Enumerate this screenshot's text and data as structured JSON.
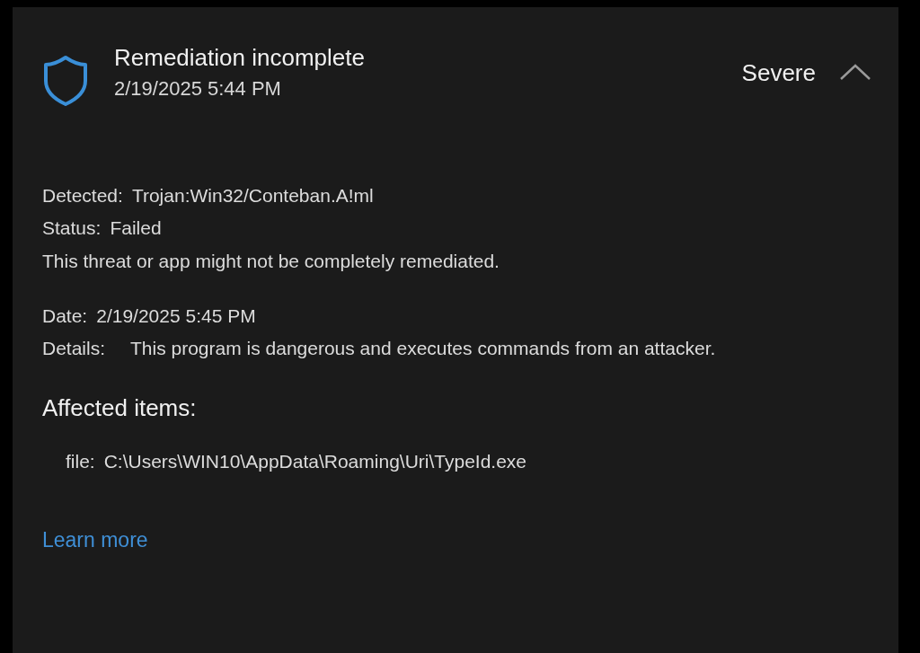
{
  "threat": {
    "title": "Remediation incomplete",
    "timestamp": "2/19/2025 5:44 PM",
    "severity": "Severe",
    "expanded": true
  },
  "summary": [
    {
      "label": "Detected:",
      "value": "Trojan:Win32/Conteban.A!ml"
    },
    {
      "label": "Status:",
      "value": "Failed"
    }
  ],
  "note": "This threat or app might not be completely remediated.",
  "info": [
    {
      "label": "Date:",
      "value": "2/19/2025 5:45 PM"
    },
    {
      "label": "Details:",
      "value": "This program is dangerous and executes commands from an attacker."
    }
  ],
  "affected_items": {
    "heading": "Affected items:",
    "items": [
      {
        "label": "file:",
        "value": "C:\\Users\\WIN10\\AppData\\Roaming\\Uri\\TypeId.exe"
      }
    ]
  },
  "link": "Learn more"
}
